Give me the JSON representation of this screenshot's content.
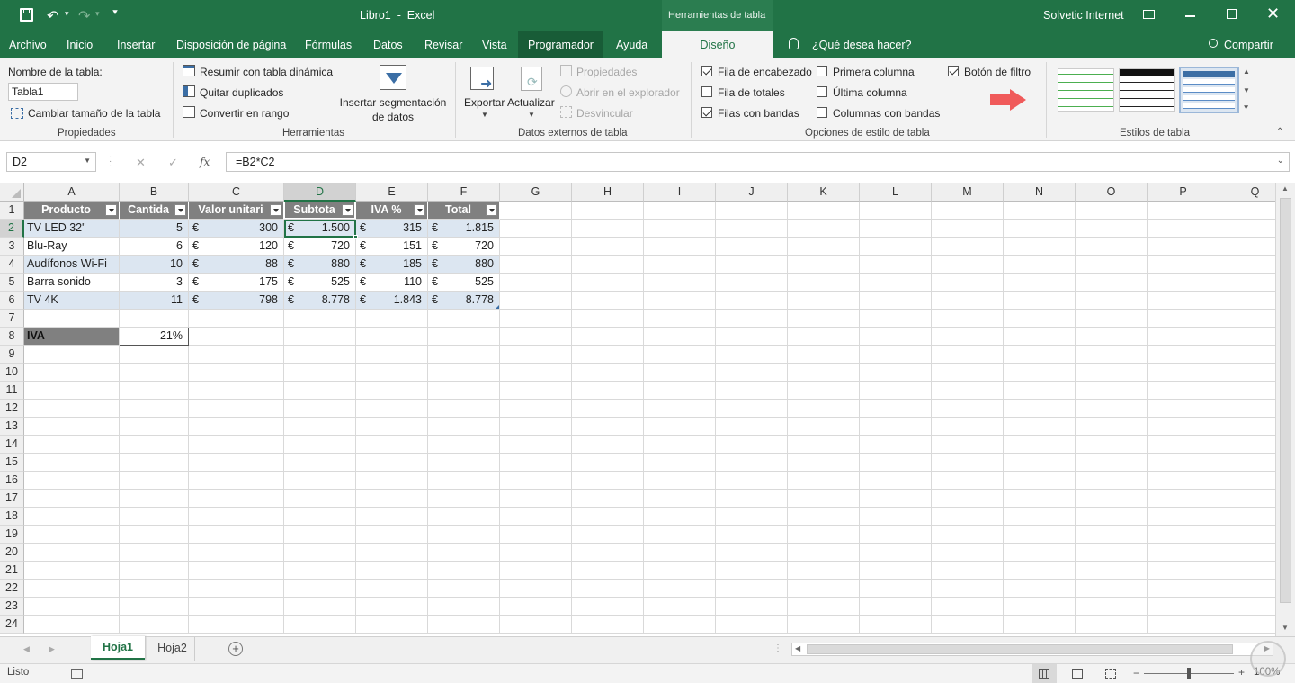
{
  "title_bar": {
    "window_title": "Libro1  -  Excel",
    "contextual_tools": "Herramientas de tabla",
    "user": "Solvetic Internet"
  },
  "tabs": [
    "Archivo",
    "Inicio",
    "Insertar",
    "Disposición de página",
    "Fórmulas",
    "Datos",
    "Revisar",
    "Vista",
    "Programador",
    "Ayuda",
    "Diseño"
  ],
  "tell_me": "¿Qué desea hacer?",
  "share": "Compartir",
  "ribbon": {
    "propiedades": {
      "table_name_label": "Nombre de la tabla:",
      "table_name_value": "Tabla1",
      "resize": "Cambiar tamaño de la tabla",
      "group": "Propiedades"
    },
    "herramientas": {
      "pivot": "Resumir con tabla dinámica",
      "remove_dup": "Quitar duplicados",
      "convert": "Convertir en rango",
      "slicer": "Insertar segmentación de datos",
      "group": "Herramientas"
    },
    "datos_externos": {
      "export": "Exportar",
      "refresh": "Actualizar",
      "properties": "Propiedades",
      "open_browser": "Abrir en el explorador",
      "unlink": "Desvincular",
      "group": "Datos externos de tabla"
    },
    "opciones": {
      "header_row": "Fila de encabezado",
      "total_row": "Fila de totales",
      "banded_rows": "Filas con bandas",
      "first_column": "Primera columna",
      "last_column": "Última columna",
      "banded_columns": "Columnas con bandas",
      "filter_button": "Botón de filtro",
      "group": "Opciones de estilo de tabla"
    },
    "estilos": {
      "group": "Estilos de tabla"
    }
  },
  "formula_bar": {
    "name_box": "D2",
    "fx": "fx",
    "formula": "=B2*C2"
  },
  "columns": [
    "A",
    "B",
    "C",
    "D",
    "E",
    "F",
    "G",
    "H",
    "I",
    "J",
    "K",
    "L",
    "M",
    "N",
    "O",
    "P",
    "Q"
  ],
  "rows": [
    "1",
    "2",
    "3",
    "4",
    "5",
    "6",
    "7",
    "8",
    "9",
    "10",
    "11",
    "12",
    "13",
    "14",
    "15",
    "16",
    "17",
    "18",
    "19",
    "20",
    "21",
    "22",
    "23",
    "24"
  ],
  "table": {
    "headers": [
      "Producto",
      "Cantida",
      "Valor unitari",
      "Subtota",
      "IVA %",
      "Total"
    ],
    "currency": "€",
    "data": [
      [
        "TV LED 32\"",
        "5",
        "300",
        "1.500",
        "315",
        "1.815"
      ],
      [
        "Blu-Ray",
        "6",
        "120",
        "720",
        "151",
        "720"
      ],
      [
        "Audífonos Wi-Fi",
        "10",
        "88",
        "880",
        "185",
        "880"
      ],
      [
        "Barra sonido",
        "3",
        "175",
        "525",
        "110",
        "525"
      ],
      [
        "TV 4K",
        "11",
        "798",
        "8.778",
        "1.843",
        "8.778"
      ]
    ]
  },
  "iva": {
    "label": "IVA",
    "value": "21%"
  },
  "sheets": [
    "Hoja1",
    "Hoja2"
  ],
  "status": {
    "ready": "Listo",
    "zoom": "100%"
  },
  "colors": {
    "excel_green": "#217346",
    "header_gray": "#808080",
    "band_blue": "#dce6f1",
    "arrow": "#f05a5a"
  }
}
